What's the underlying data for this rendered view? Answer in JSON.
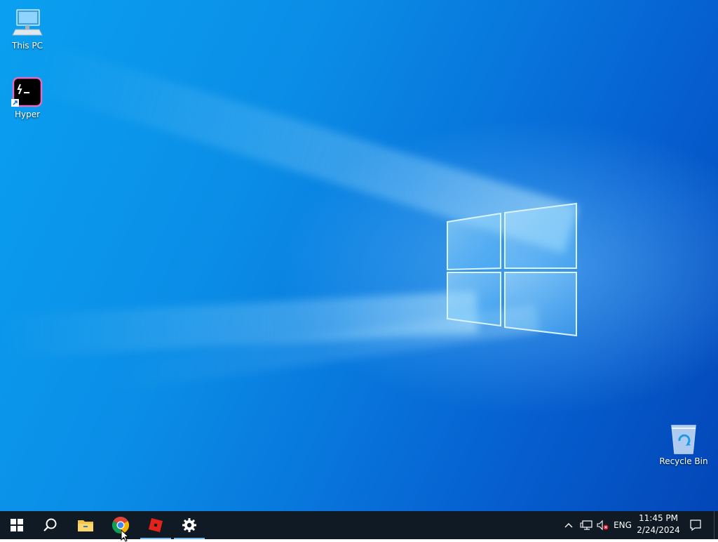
{
  "desktop": {
    "icons": [
      {
        "label": "This PC",
        "icon": "this-pc-icon"
      },
      {
        "label": "Hyper",
        "icon": "hyper-terminal-icon"
      },
      {
        "label": "Recycle Bin",
        "icon": "recycle-bin-icon"
      }
    ],
    "wallpaper": {
      "primary": "#0a8de6",
      "dark": "#0346b8",
      "glow": "#9fdcff"
    }
  },
  "taskbar": {
    "background": "#0f1a24",
    "pinned": [
      {
        "name": "Start",
        "icon": "windows-start-icon"
      },
      {
        "name": "Search",
        "icon": "search-icon"
      },
      {
        "name": "File Explorer",
        "icon": "file-explorer-icon"
      },
      {
        "name": "Google Chrome",
        "icon": "chrome-icon"
      },
      {
        "name": "Roblox",
        "icon": "roblox-icon"
      },
      {
        "name": "Settings",
        "icon": "settings-gear-icon"
      }
    ],
    "tray": {
      "chevron": "show-hidden-icons",
      "network": "network-icon",
      "volume": "volume-muted-icon",
      "language": "ENG",
      "time": "11:45 PM",
      "date": "2/24/2024",
      "notifications": "action-center-icon"
    }
  }
}
